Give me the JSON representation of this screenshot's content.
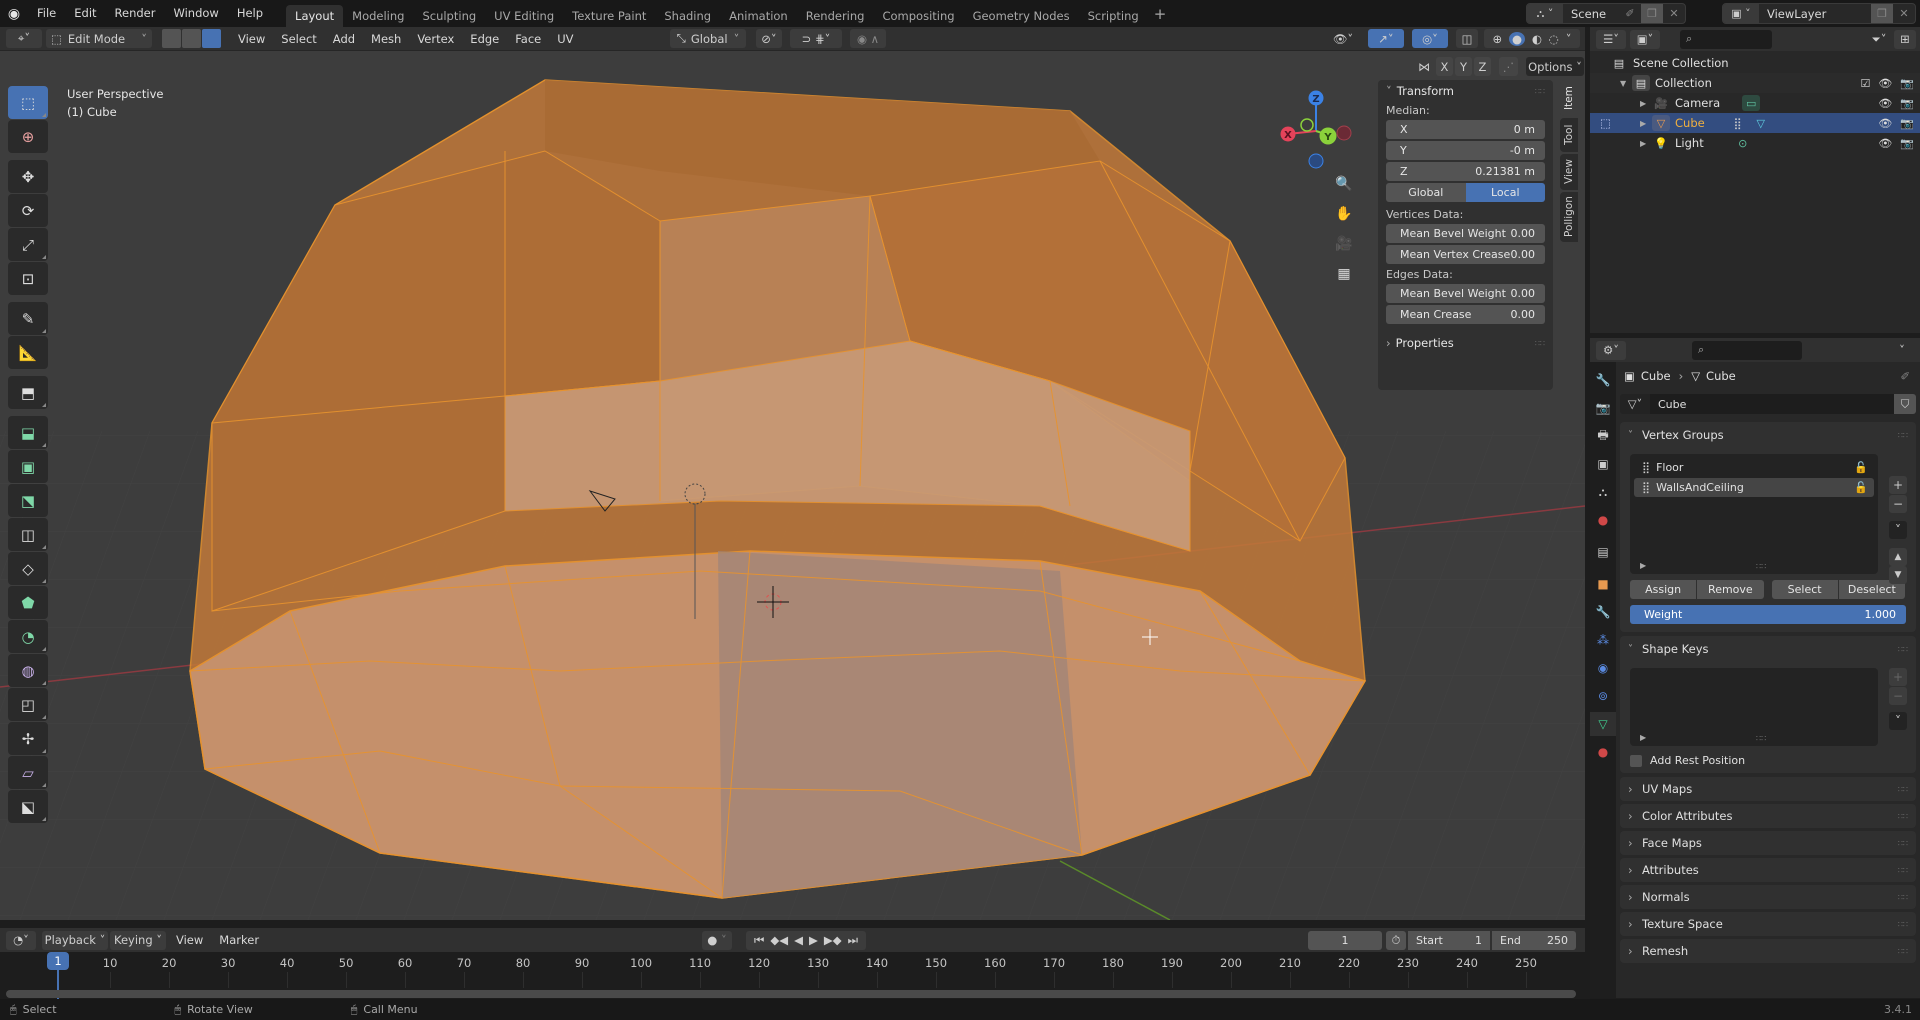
{
  "app": {
    "logo": "blender-logo",
    "version": "3.4.1"
  },
  "menu": [
    "File",
    "Edit",
    "Render",
    "Window",
    "Help"
  ],
  "workspaces": [
    {
      "label": "Layout",
      "active": true
    },
    {
      "label": "Modeling",
      "active": false
    },
    {
      "label": "Sculpting",
      "active": false
    },
    {
      "label": "UV Editing",
      "active": false
    },
    {
      "label": "Texture Paint",
      "active": false
    },
    {
      "label": "Shading",
      "active": false
    },
    {
      "label": "Animation",
      "active": false
    },
    {
      "label": "Rendering",
      "active": false
    },
    {
      "label": "Compositing",
      "active": false
    },
    {
      "label": "Geometry Nodes",
      "active": false
    },
    {
      "label": "Scripting",
      "active": false
    }
  ],
  "workspace_add": "+",
  "scene": {
    "name": "Scene",
    "view_layer": "ViewLayer"
  },
  "viewport_header": {
    "mode": "Edit Mode",
    "menus": [
      "View",
      "Select",
      "Add",
      "Mesh",
      "Vertex",
      "Edge",
      "Face",
      "UV"
    ],
    "transform_orientation": "Global",
    "select_modes": [
      "vertex",
      "edge",
      "face"
    ],
    "active_select_mode": "face",
    "mirror_axes": [
      "X",
      "Y",
      "Z"
    ],
    "options_label": "Options"
  },
  "viewport": {
    "view_name": "User Perspective",
    "object_label": "(1) Cube",
    "gizmo_axes": {
      "x": "X",
      "y": "Y",
      "z": "Z"
    },
    "colors": {
      "x": "#e5435a",
      "y": "#8bd13b",
      "z": "#3b82e6",
      "mesh": "#d69456",
      "edge": "#e8932e",
      "grid_bg": "#3d3d3d"
    }
  },
  "tools": [
    {
      "name": "select-box",
      "active": true
    },
    {
      "name": "cursor",
      "active": false
    },
    {
      "name": "move",
      "active": false
    },
    {
      "name": "rotate",
      "active": false
    },
    {
      "name": "scale",
      "active": false
    },
    {
      "name": "transform",
      "active": false
    },
    {
      "name": "annotate",
      "active": false
    },
    {
      "name": "measure",
      "active": false
    },
    {
      "name": "add-cube",
      "active": false
    },
    {
      "name": "extrude-region",
      "active": false
    },
    {
      "name": "inset-faces",
      "active": false
    },
    {
      "name": "bevel",
      "active": false
    },
    {
      "name": "loop-cut",
      "active": false
    },
    {
      "name": "knife",
      "active": false
    },
    {
      "name": "poly-build",
      "active": false
    },
    {
      "name": "spin",
      "active": false
    },
    {
      "name": "smooth",
      "active": false
    },
    {
      "name": "edge-slide",
      "active": false
    },
    {
      "name": "shrink-fatten",
      "active": false
    },
    {
      "name": "shear",
      "active": false
    },
    {
      "name": "rip-region",
      "active": false
    }
  ],
  "npanel": {
    "tabs": [
      "Item",
      "Tool",
      "View",
      "Polligon"
    ],
    "active_tab": "Item",
    "transform_title": "Transform",
    "median_label": "Median:",
    "median": [
      {
        "axis": "X",
        "value": "0 m"
      },
      {
        "axis": "Y",
        "value": "-0 m"
      },
      {
        "axis": "Z",
        "value": "0.21381 m"
      }
    ],
    "space_toggle": [
      {
        "label": "Global",
        "on": false
      },
      {
        "label": "Local",
        "on": true
      }
    ],
    "vertices_data_label": "Vertices Data:",
    "vertices_data": [
      {
        "label": "Mean Bevel Weight",
        "value": "0.00"
      },
      {
        "label": "Mean Vertex Crease",
        "value": "0.00"
      }
    ],
    "edges_data_label": "Edges Data:",
    "edges_data": [
      {
        "label": "Mean Bevel Weight",
        "value": "0.00"
      },
      {
        "label": "Mean Crease",
        "value": "0.00"
      }
    ],
    "properties_label": "Properties"
  },
  "outliner": {
    "search_placeholder": "",
    "rows": [
      {
        "label": "Scene Collection",
        "type": "scene-collection"
      },
      {
        "label": "Collection",
        "type": "collection",
        "checked": true
      },
      {
        "label": "Camera",
        "type": "camera"
      },
      {
        "label": "Cube",
        "type": "mesh",
        "selected": true
      },
      {
        "label": "Light",
        "type": "light"
      }
    ]
  },
  "properties": {
    "search_placeholder": "",
    "breadcrumb": [
      "Cube",
      "Cube"
    ],
    "mesh_name": "Cube",
    "vertex_groups": {
      "title": "Vertex Groups",
      "items": [
        {
          "name": "Floor",
          "selected": false
        },
        {
          "name": "WallsAndCeiling",
          "selected": true
        }
      ],
      "buttons": [
        "Assign",
        "Remove",
        "Select",
        "Deselect"
      ],
      "weight_label": "Weight",
      "weight_value": "1.000"
    },
    "shape_keys": {
      "title": "Shape Keys",
      "add_rest_position": "Add Rest Position",
      "checked": false
    },
    "collapsed_panels": [
      "UV Maps",
      "Color Attributes",
      "Face Maps",
      "Attributes",
      "Normals",
      "Texture Space",
      "Remesh"
    ]
  },
  "timeline": {
    "menus": [
      "Playback",
      "Keying",
      "View",
      "Marker"
    ],
    "current_frame": "1",
    "start_label": "Start",
    "start": "1",
    "end_label": "End",
    "end": "250",
    "ticks": [
      "1",
      "10",
      "20",
      "30",
      "40",
      "50",
      "60",
      "70",
      "80",
      "90",
      "100",
      "110",
      "120",
      "130",
      "140",
      "150",
      "160",
      "170",
      "180",
      "190",
      "200",
      "210",
      "220",
      "230",
      "240",
      "250"
    ]
  },
  "statusbar": [
    {
      "icon": "mouse-left-icon",
      "label": "Select"
    },
    {
      "icon": "mouse-middle-icon",
      "label": "Rotate View"
    },
    {
      "icon": "mouse-right-icon",
      "label": "Call Menu"
    }
  ]
}
